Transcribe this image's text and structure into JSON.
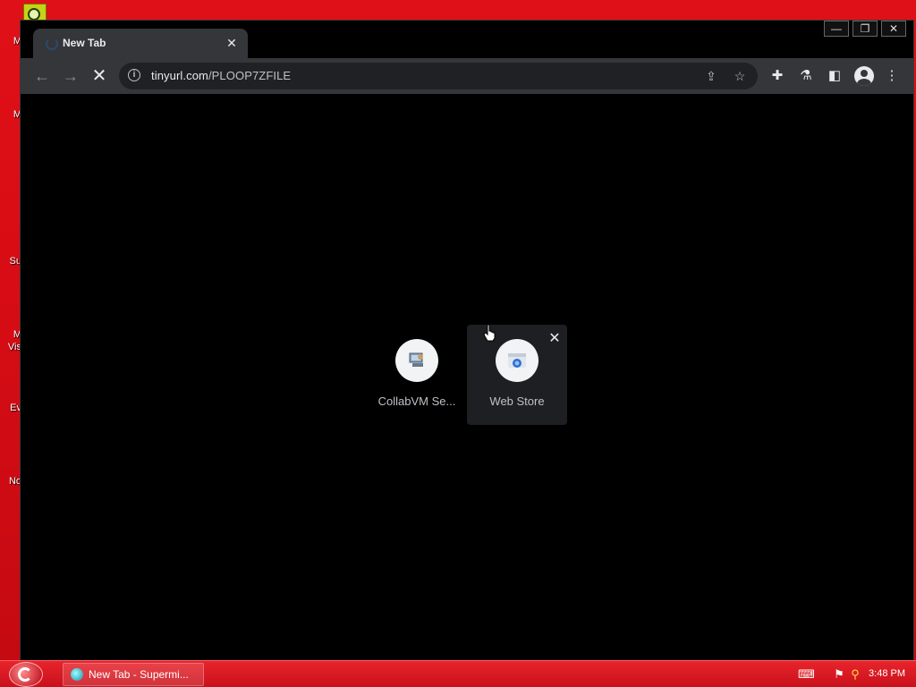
{
  "desktop": {
    "icon_labels": [
      "M",
      "M",
      "Su",
      "M",
      "Vis",
      "Ev",
      "No"
    ]
  },
  "browser": {
    "tab": {
      "title": "New Tab",
      "close_glyph": "✕"
    },
    "window_controls": {
      "minimize": "—",
      "maximize": "❐",
      "close": "✕"
    },
    "toolbar": {
      "back": "←",
      "forward": "→",
      "stop": "✕",
      "url_host": "tinyurl.com",
      "url_path": "/PLOOP7ZFILE",
      "share": "⇪",
      "bookmark": "☆",
      "extensions": "✚",
      "labs": "⚗",
      "side_panel": "◧",
      "menu": "⋮"
    },
    "shortcuts": [
      {
        "label": "CollabVM Se...",
        "icon": "collabvm-icon"
      },
      {
        "label": "Web Store",
        "icon": "web-store-icon",
        "remove": "✕"
      }
    ]
  },
  "taskbar": {
    "task_label": "New Tab - Supermi...",
    "clock": "3:48 PM",
    "tray": {
      "keyboard": "⌨",
      "network": "⚑",
      "search": "⚲"
    }
  }
}
